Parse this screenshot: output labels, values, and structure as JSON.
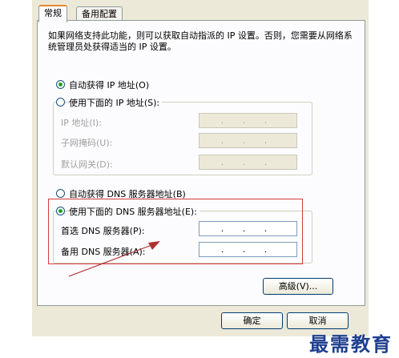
{
  "tabs": {
    "general": "常规",
    "alternate": "备用配置"
  },
  "description": "如果网络支持此功能，则可以获取自动指派的 IP 设置。否则，您需要从网络系统管理员处获得适当的 IP 设置。",
  "ip": {
    "auto_label": "自动获得 IP 地址(O)",
    "manual_label": "使用下面的 IP 地址(S):",
    "address_label": "IP 地址(I):",
    "mask_label": "子网掩码(U):",
    "gateway_label": "默认网关(D):",
    "address_value": ". . .",
    "mask_value": ". . .",
    "gateway_value": ". . .",
    "selected": "auto"
  },
  "dns": {
    "auto_label": "自动获得 DNS 服务器地址(B)",
    "manual_label": "使用下面的 DNS 服务器地址(E):",
    "preferred_label": "首选 DNS 服务器(P):",
    "alternate_label": "备用 DNS 服务器(A):",
    "preferred_value": ". . .",
    "alternate_value": ". . .",
    "selected": "manual"
  },
  "buttons": {
    "advanced": "高级(V)...",
    "ok": "确定",
    "cancel": "取消"
  },
  "watermark": "最需教育",
  "colors": {
    "highlight": "#d63b3b",
    "arrow": "#b03030",
    "tab_accent": "#e68b2c",
    "radio_dot": "#21a121"
  }
}
